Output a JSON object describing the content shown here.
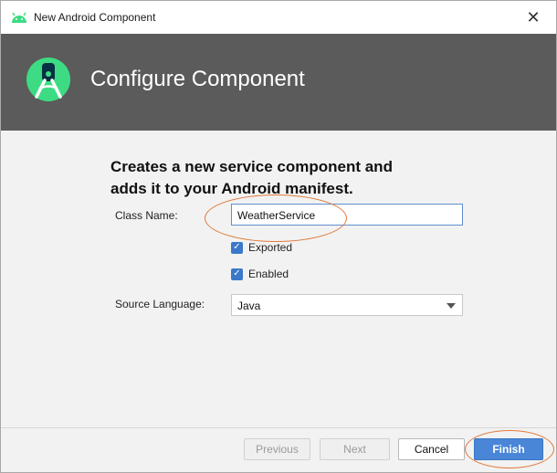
{
  "window": {
    "title": "New Android Component",
    "close_glyph": "✕"
  },
  "banner": {
    "title": "Configure Component",
    "logo_icon": "android-studio-icon",
    "background": "#5b5b5b"
  },
  "form": {
    "heading_line1": "Creates a new service component and",
    "heading_line2": "adds it to your Android manifest.",
    "class_name_label": "Class Name:",
    "class_name_value": "WeatherService",
    "exported_label": "Exported",
    "exported_checked": true,
    "enabled_label": "Enabled",
    "enabled_checked": true,
    "source_language_label": "Source Language:",
    "source_language_value": "Java"
  },
  "footer": {
    "previous_label": "Previous",
    "next_label": "Next",
    "cancel_label": "Cancel",
    "finish_label": "Finish"
  },
  "colors": {
    "accent": "#4a86d8",
    "annotation": "#e07a3a",
    "android_green": "#3ddc84"
  }
}
